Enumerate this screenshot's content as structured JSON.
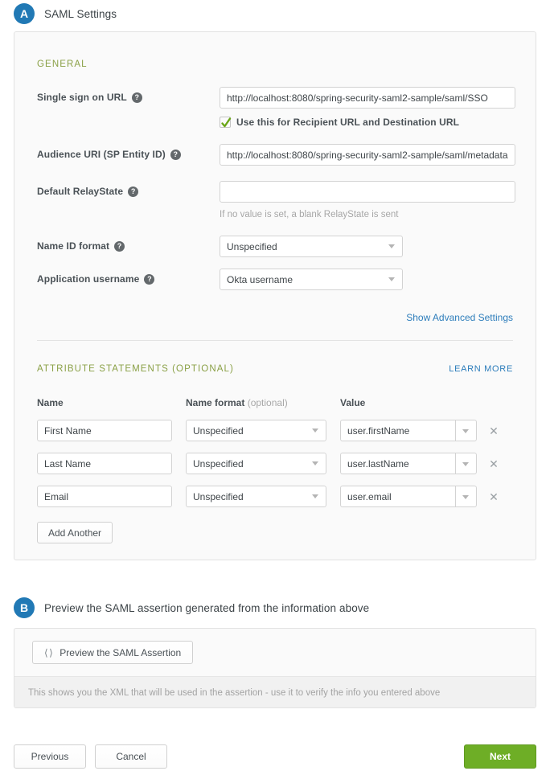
{
  "section_a": {
    "badge": "A",
    "title": "SAML Settings",
    "group_label": "GENERAL",
    "fields": {
      "sso_url": {
        "label": "Single sign on URL",
        "help_icon": "question-icon",
        "value": "http://localhost:8080/spring-security-saml2-sample/saml/SSO",
        "checkbox_label": "Use this for Recipient URL and Destination URL",
        "checkbox_checked": true
      },
      "audience_uri": {
        "label": "Audience URI (SP Entity ID)",
        "help_icon": "question-icon",
        "value": "http://localhost:8080/spring-security-saml2-sample/saml/metadata"
      },
      "default_relaystate": {
        "label": "Default RelayState",
        "help_icon": "question-icon",
        "value": "",
        "hint": "If no value is set, a blank RelayState is sent"
      },
      "name_id_format": {
        "label": "Name ID format",
        "help_icon": "question-icon",
        "value": "Unspecified"
      },
      "application_username": {
        "label": "Application username",
        "help_icon": "question-icon",
        "value": "Okta username"
      }
    },
    "advanced_link": "Show Advanced Settings",
    "attributes": {
      "title": "ATTRIBUTE STATEMENTS (OPTIONAL)",
      "learn_more": "LEARN MORE",
      "columns": {
        "name": "Name",
        "name_format": "Name format",
        "name_format_optional": "(optional)",
        "value": "Value"
      },
      "rows": [
        {
          "name": "First Name",
          "format": "Unspecified",
          "value": "user.firstName",
          "delete_icon": "close-icon"
        },
        {
          "name": "Last Name",
          "format": "Unspecified",
          "value": "user.lastName",
          "delete_icon": "close-icon"
        },
        {
          "name": "Email",
          "format": "Unspecified",
          "value": "user.email",
          "delete_icon": "close-icon"
        }
      ],
      "add_another": "Add Another"
    }
  },
  "section_b": {
    "badge": "B",
    "title": "Preview the SAML assertion generated from the information above",
    "preview_button": "Preview the SAML Assertion",
    "preview_icon": "code-brackets-icon",
    "footer_note": "This shows you the XML that will be used in the assertion - use it to verify the info you entered above"
  },
  "footer": {
    "previous": "Previous",
    "cancel": "Cancel",
    "next": "Next"
  },
  "colors": {
    "badge_blue": "#2179b5",
    "group_green": "#8aa046",
    "link_blue": "#2d7dbb",
    "next_green": "#6eae26",
    "panel_bg": "#fafafa",
    "check_green": "#6aa617"
  }
}
